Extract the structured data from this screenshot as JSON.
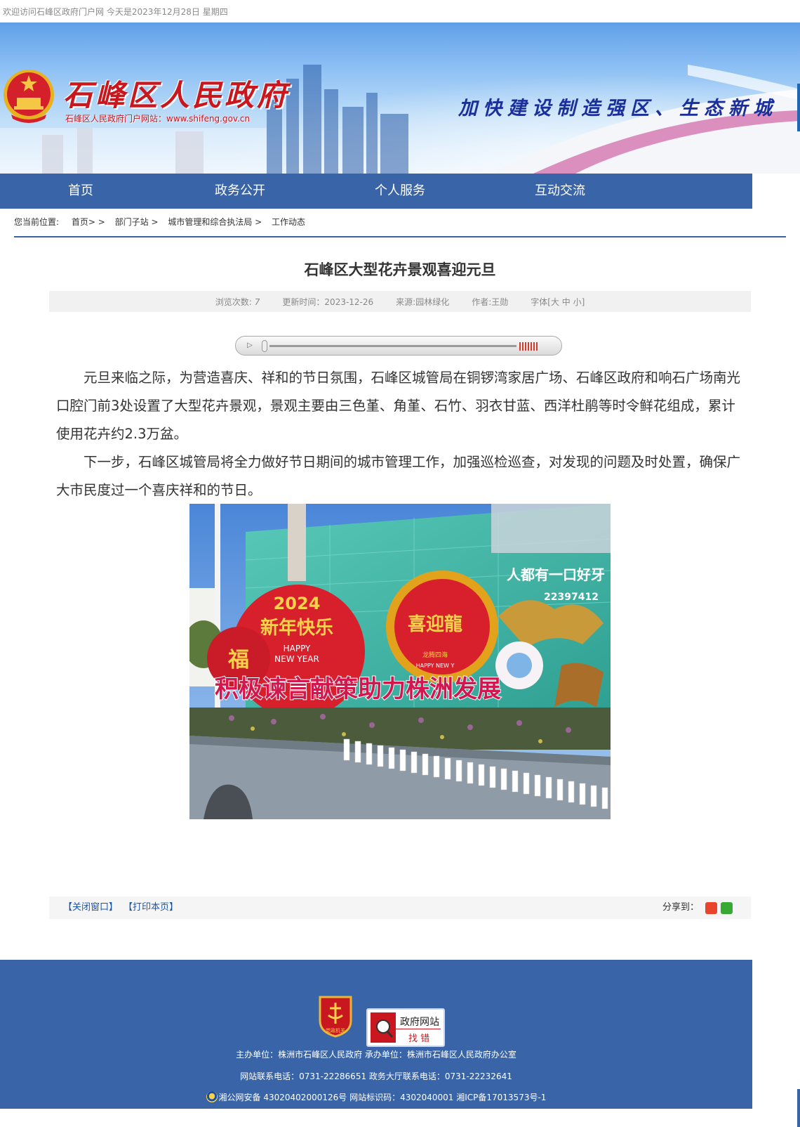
{
  "topbar": {
    "welcome": "欢迎访问石峰区政府门户网 今天是2023年12月28日 星期四"
  },
  "header": {
    "title": "石峰区人民政府",
    "url_label": "石峰区人民政府门户网站：www.shifeng.gov.cn",
    "slogan": "加快建设制造强区、生态新城"
  },
  "nav": {
    "items": [
      "首页",
      "政务公开",
      "个人服务",
      "互动交流"
    ]
  },
  "breadcrumb": {
    "label": "您当前位置:",
    "items": [
      "首页> >",
      "部门子站 >",
      "城市管理和综合执法局 >",
      "工作动态"
    ]
  },
  "article": {
    "title": "石峰区大型花卉景观喜迎元旦",
    "meta": {
      "views_label": "浏览次数:",
      "views": "7",
      "updated": "更新时间：2023-12-26",
      "source": "来源:园林绿化",
      "author": "作者:王勋",
      "font_size": "字体[大 中 小]"
    },
    "paragraphs": [
      "元旦来临之际，为营造喜庆、祥和的节日氛围，石峰区城管局在铜锣湾家居广场、石峰区政府和响石广场南光口腔门前3处设置了大型花卉景观，景观主要由三色堇、角堇、石竹、羽衣甘蓝、西洋杜鹃等时令鲜花组成，累计使用花卉约2.3万盆。",
      "下一步，石峰区城管局将全力做好节日期间的城市管理工作，加强巡检巡查，对发现的问题及时处置，确保广大市民度过一个喜庆祥和的节日。"
    ],
    "photo": {
      "year": "2024",
      "greeting": "新年快乐",
      "happy_en": "HAPPY",
      "new_year_en": "NEW YEAR",
      "fu": "福",
      "dragon": "喜迎龍",
      "dragon_sub": "龙腾四海",
      "dragon_en": "HAPPY NEW Y",
      "banner_text": "积极谏言献策助力株洲发展",
      "store_sign": "人都有一口好牙",
      "store_phone": "22397412"
    }
  },
  "actions": {
    "close": "【关闭窗口】",
    "print": "【打印本页】",
    "share_label": "分享到："
  },
  "footer": {
    "badge_party": "党政机关",
    "badge_fix_title": "政府网站",
    "badge_fix_sub": "找 错",
    "host_line": "主办单位：株洲市石峰区人民政府 承办单位：株洲市石峰区人民政府办公室",
    "contact_line": "网站联系电话：0731-22286651 政务大厅联系电话：0731-22232641",
    "record_line": "湘公网安备 43020402000126号 网站标识码：4302040001 湘ICP备17013573号-1"
  },
  "colors": {
    "nav": "#3a64a8",
    "title_red": "#c8171e",
    "slogan_blue": "#1b2f9c"
  }
}
